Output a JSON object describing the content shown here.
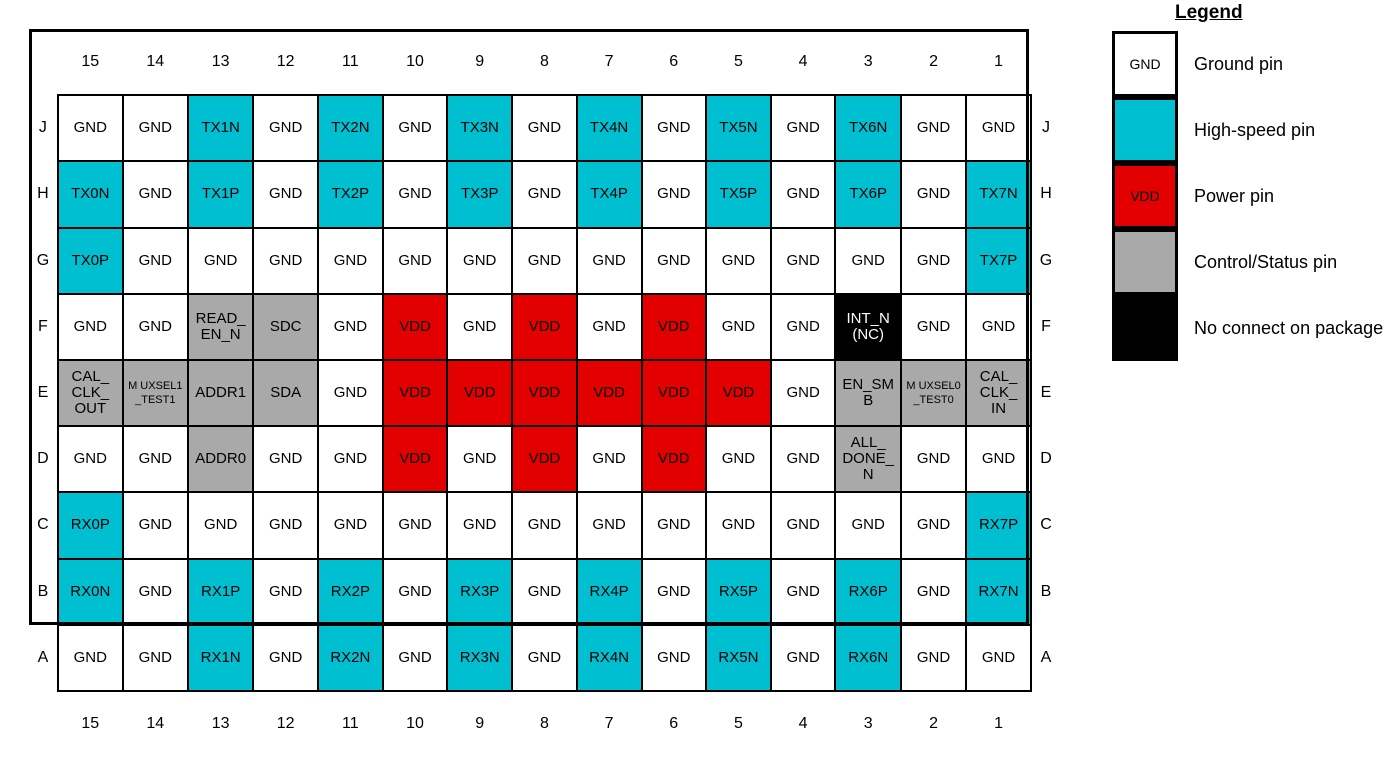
{
  "grid": {
    "col_headers": [
      "15",
      "14",
      "13",
      "12",
      "11",
      "10",
      "9",
      "8",
      "7",
      "6",
      "5",
      "4",
      "3",
      "2",
      "1"
    ],
    "row_labels": [
      "J",
      "H",
      "G",
      "F",
      "E",
      "D",
      "C",
      "B",
      "A"
    ],
    "rows": [
      {
        "label": "J",
        "cells": [
          {
            "text": "GND",
            "type": "gnd"
          },
          {
            "text": "GND",
            "type": "gnd"
          },
          {
            "text": "TX1N",
            "type": "hs"
          },
          {
            "text": "GND",
            "type": "gnd"
          },
          {
            "text": "TX2N",
            "type": "hs"
          },
          {
            "text": "GND",
            "type": "gnd"
          },
          {
            "text": "TX3N",
            "type": "hs"
          },
          {
            "text": "GND",
            "type": "gnd"
          },
          {
            "text": "TX4N",
            "type": "hs"
          },
          {
            "text": "GND",
            "type": "gnd"
          },
          {
            "text": "TX5N",
            "type": "hs"
          },
          {
            "text": "GND",
            "type": "gnd"
          },
          {
            "text": "TX6N",
            "type": "hs"
          },
          {
            "text": "GND",
            "type": "gnd"
          },
          {
            "text": "GND",
            "type": "gnd"
          }
        ]
      },
      {
        "label": "H",
        "cells": [
          {
            "text": "TX0N",
            "type": "hs"
          },
          {
            "text": "GND",
            "type": "gnd"
          },
          {
            "text": "TX1P",
            "type": "hs"
          },
          {
            "text": "GND",
            "type": "gnd"
          },
          {
            "text": "TX2P",
            "type": "hs"
          },
          {
            "text": "GND",
            "type": "gnd"
          },
          {
            "text": "TX3P",
            "type": "hs"
          },
          {
            "text": "GND",
            "type": "gnd"
          },
          {
            "text": "TX4P",
            "type": "hs"
          },
          {
            "text": "GND",
            "type": "gnd"
          },
          {
            "text": "TX5P",
            "type": "hs"
          },
          {
            "text": "GND",
            "type": "gnd"
          },
          {
            "text": "TX6P",
            "type": "hs"
          },
          {
            "text": "GND",
            "type": "gnd"
          },
          {
            "text": "TX7N",
            "type": "hs"
          }
        ]
      },
      {
        "label": "G",
        "cells": [
          {
            "text": "TX0P",
            "type": "hs"
          },
          {
            "text": "GND",
            "type": "gnd"
          },
          {
            "text": "GND",
            "type": "gnd"
          },
          {
            "text": "GND",
            "type": "gnd"
          },
          {
            "text": "GND",
            "type": "gnd"
          },
          {
            "text": "GND",
            "type": "gnd"
          },
          {
            "text": "GND",
            "type": "gnd"
          },
          {
            "text": "GND",
            "type": "gnd"
          },
          {
            "text": "GND",
            "type": "gnd"
          },
          {
            "text": "GND",
            "type": "gnd"
          },
          {
            "text": "GND",
            "type": "gnd"
          },
          {
            "text": "GND",
            "type": "gnd"
          },
          {
            "text": "GND",
            "type": "gnd"
          },
          {
            "text": "GND",
            "type": "gnd"
          },
          {
            "text": "TX7P",
            "type": "hs"
          }
        ]
      },
      {
        "label": "F",
        "cells": [
          {
            "text": "GND",
            "type": "gnd"
          },
          {
            "text": "GND",
            "type": "gnd"
          },
          {
            "lines": [
              "READ_",
              "EN_N"
            ],
            "type": "ctl"
          },
          {
            "text": "SDC",
            "type": "ctl"
          },
          {
            "text": "GND",
            "type": "gnd"
          },
          {
            "text": "VDD",
            "type": "vdd"
          },
          {
            "text": "GND",
            "type": "gnd"
          },
          {
            "text": "VDD",
            "type": "vdd"
          },
          {
            "text": "GND",
            "type": "gnd"
          },
          {
            "text": "VDD",
            "type": "vdd"
          },
          {
            "text": "GND",
            "type": "gnd"
          },
          {
            "text": "GND",
            "type": "gnd"
          },
          {
            "lines": [
              "INT_N",
              "(NC)"
            ],
            "type": "nc"
          },
          {
            "text": "GND",
            "type": "gnd"
          },
          {
            "text": "GND",
            "type": "gnd"
          }
        ]
      },
      {
        "label": "E",
        "cells": [
          {
            "lines": [
              "CAL_",
              "CLK_",
              "OUT"
            ],
            "type": "ctl"
          },
          {
            "lines": [
              "M UXSEL1",
              "_TEST1"
            ],
            "type": "ctl",
            "small": true
          },
          {
            "text": "ADDR1",
            "type": "ctl"
          },
          {
            "text": "SDA",
            "type": "ctl"
          },
          {
            "text": "GND",
            "type": "gnd"
          },
          {
            "text": "VDD",
            "type": "vdd"
          },
          {
            "text": "VDD",
            "type": "vdd"
          },
          {
            "text": "VDD",
            "type": "vdd"
          },
          {
            "text": "VDD",
            "type": "vdd"
          },
          {
            "text": "VDD",
            "type": "vdd"
          },
          {
            "text": "VDD",
            "type": "vdd"
          },
          {
            "text": "GND",
            "type": "gnd"
          },
          {
            "lines": [
              "EN_SM",
              "B"
            ],
            "type": "ctl"
          },
          {
            "lines": [
              "M UXSEL0",
              "_TEST0"
            ],
            "type": "ctl",
            "small": true
          },
          {
            "lines": [
              "CAL_",
              "CLK_",
              "IN"
            ],
            "type": "ctl"
          }
        ]
      },
      {
        "label": "D",
        "cells": [
          {
            "text": "GND",
            "type": "gnd"
          },
          {
            "text": "GND",
            "type": "gnd"
          },
          {
            "text": "ADDR0",
            "type": "ctl"
          },
          {
            "text": "GND",
            "type": "gnd"
          },
          {
            "text": "GND",
            "type": "gnd"
          },
          {
            "text": "VDD",
            "type": "vdd"
          },
          {
            "text": "GND",
            "type": "gnd"
          },
          {
            "text": "VDD",
            "type": "vdd"
          },
          {
            "text": "GND",
            "type": "gnd"
          },
          {
            "text": "VDD",
            "type": "vdd"
          },
          {
            "text": "GND",
            "type": "gnd"
          },
          {
            "text": "GND",
            "type": "gnd"
          },
          {
            "lines": [
              "ALL_",
              "DONE_",
              "N"
            ],
            "type": "ctl"
          },
          {
            "text": "GND",
            "type": "gnd"
          },
          {
            "text": "GND",
            "type": "gnd"
          }
        ]
      },
      {
        "label": "C",
        "cells": [
          {
            "text": "RX0P",
            "type": "hs"
          },
          {
            "text": "GND",
            "type": "gnd"
          },
          {
            "text": "GND",
            "type": "gnd"
          },
          {
            "text": "GND",
            "type": "gnd"
          },
          {
            "text": "GND",
            "type": "gnd"
          },
          {
            "text": "GND",
            "type": "gnd"
          },
          {
            "text": "GND",
            "type": "gnd"
          },
          {
            "text": "GND",
            "type": "gnd"
          },
          {
            "text": "GND",
            "type": "gnd"
          },
          {
            "text": "GND",
            "type": "gnd"
          },
          {
            "text": "GND",
            "type": "gnd"
          },
          {
            "text": "GND",
            "type": "gnd"
          },
          {
            "text": "GND",
            "type": "gnd"
          },
          {
            "text": "GND",
            "type": "gnd"
          },
          {
            "text": "RX7P",
            "type": "hs"
          }
        ]
      },
      {
        "label": "B",
        "cells": [
          {
            "text": "RX0N",
            "type": "hs"
          },
          {
            "text": "GND",
            "type": "gnd"
          },
          {
            "text": "RX1P",
            "type": "hs"
          },
          {
            "text": "GND",
            "type": "gnd"
          },
          {
            "text": "RX2P",
            "type": "hs"
          },
          {
            "text": "GND",
            "type": "gnd"
          },
          {
            "text": "RX3P",
            "type": "hs"
          },
          {
            "text": "GND",
            "type": "gnd"
          },
          {
            "text": "RX4P",
            "type": "hs"
          },
          {
            "text": "GND",
            "type": "gnd"
          },
          {
            "text": "RX5P",
            "type": "hs"
          },
          {
            "text": "GND",
            "type": "gnd"
          },
          {
            "text": "RX6P",
            "type": "hs"
          },
          {
            "text": "GND",
            "type": "gnd"
          },
          {
            "text": "RX7N",
            "type": "hs"
          }
        ]
      },
      {
        "label": "A",
        "cells": [
          {
            "text": "GND",
            "type": "gnd"
          },
          {
            "text": "GND",
            "type": "gnd"
          },
          {
            "text": "RX1N",
            "type": "hs"
          },
          {
            "text": "GND",
            "type": "gnd"
          },
          {
            "text": "RX2N",
            "type": "hs"
          },
          {
            "text": "GND",
            "type": "gnd"
          },
          {
            "text": "RX3N",
            "type": "hs"
          },
          {
            "text": "GND",
            "type": "gnd"
          },
          {
            "text": "RX4N",
            "type": "hs"
          },
          {
            "text": "GND",
            "type": "gnd"
          },
          {
            "text": "RX5N",
            "type": "hs"
          },
          {
            "text": "GND",
            "type": "gnd"
          },
          {
            "text": "RX6N",
            "type": "hs"
          },
          {
            "text": "GND",
            "type": "gnd"
          },
          {
            "text": "GND",
            "type": "gnd"
          }
        ]
      }
    ]
  },
  "legend": {
    "title": "Legend",
    "items": [
      {
        "swatch_text": "GND",
        "type": "gnd",
        "description": "Ground pin"
      },
      {
        "swatch_text": "",
        "type": "hs",
        "description": "High-speed pin"
      },
      {
        "swatch_text": "VDD",
        "type": "vdd",
        "description": "Power pin"
      },
      {
        "swatch_text": "",
        "type": "ctl",
        "description": "Control/Status pin"
      },
      {
        "swatch_text": "",
        "type": "nc",
        "description": "No connect on package"
      }
    ]
  },
  "colors": {
    "ground": "#FFFFFF",
    "high_speed": "#00BFD1",
    "power": "#E30000",
    "control_status": "#A9A9A9",
    "no_connect": "#000000",
    "outline": "#000000"
  }
}
